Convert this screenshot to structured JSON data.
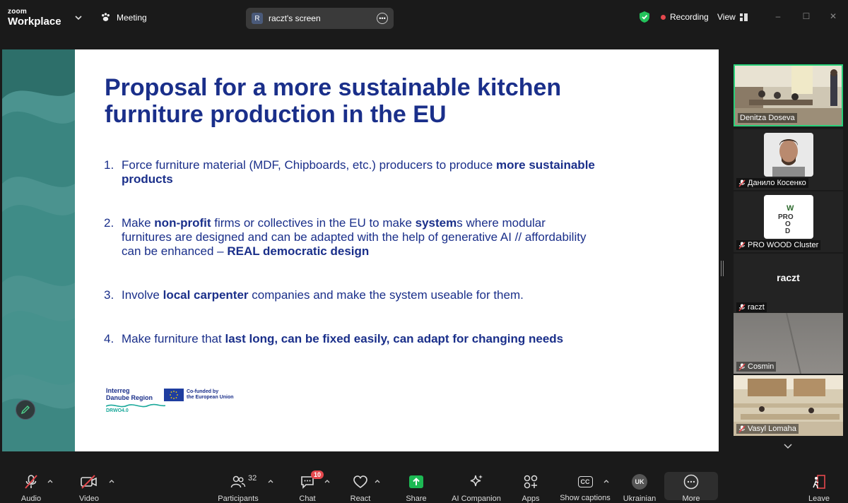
{
  "app": {
    "brand_small": "zoom",
    "brand_big": "Workplace",
    "meeting_label": "Meeting"
  },
  "share_pill": {
    "avatar_letter": "R",
    "label": "raczt's screen"
  },
  "status": {
    "recording": "Recording",
    "view": "View"
  },
  "slide": {
    "title": "Proposal for a more sustainable kitchen furniture production in the EU",
    "items": [
      {
        "num": "1.",
        "parts": [
          {
            "t": "Force furniture material (MDF, Chipboards, etc.) producers to produce ",
            "b": false
          },
          {
            "t": "more sustainable products",
            "b": true
          }
        ]
      },
      {
        "num": "2.",
        "parts": [
          {
            "t": "Make ",
            "b": false
          },
          {
            "t": "non-profit",
            "b": true
          },
          {
            "t": " firms or collectives in the EU to make ",
            "b": false
          },
          {
            "t": "system",
            "b": true
          },
          {
            "t": "s where modular furnitures are designed and can be adapted with the help of generative AI // affordability can be enhanced – ",
            "b": false
          },
          {
            "t": "REAL democratic design",
            "b": true
          }
        ]
      },
      {
        "num": "3.",
        "parts": [
          {
            "t": "Involve ",
            "b": false
          },
          {
            "t": "local carpenter",
            "b": true
          },
          {
            "t": " companies and make the system useable for them.",
            "b": false
          }
        ]
      },
      {
        "num": "4.",
        "parts": [
          {
            "t": "Make furniture that ",
            "b": false
          },
          {
            "t": "last long, can be fixed easily, can adapt for changing needs",
            "b": true
          }
        ]
      }
    ],
    "logo_interreg_1": "Interreg",
    "logo_interreg_2": "Danube Region",
    "logo_eu_1": "Co-funded by",
    "logo_eu_2": "the European Union",
    "logo_drwo": "DRWO4.0"
  },
  "participants": [
    {
      "name": "Denitza Doseva",
      "muted": false,
      "active": true,
      "kind": "video-room"
    },
    {
      "name": "Данило Косенко",
      "muted": true,
      "active": false,
      "kind": "photo-person"
    },
    {
      "name": "PRO WOOD Cluster",
      "muted": true,
      "active": false,
      "kind": "logo",
      "logo_text": "PRO WOOD"
    },
    {
      "name": "raczt",
      "muted": true,
      "active": false,
      "kind": "name-only",
      "center_name": "raczt"
    },
    {
      "name": "Cosmin",
      "muted": true,
      "active": false,
      "kind": "video-grey"
    },
    {
      "name": "Vasyl Lomaha",
      "muted": true,
      "active": false,
      "kind": "video-class"
    }
  ],
  "toolbar": {
    "audio": "Audio",
    "video": "Video",
    "participants": "Participants",
    "participants_count": "32",
    "chat": "Chat",
    "chat_badge": "10",
    "react": "React",
    "share": "Share",
    "ai_companion": "AI Companion",
    "apps": "Apps",
    "captions": "Show captions",
    "captions_icon": "CC",
    "language": "Ukrainian",
    "language_icon": "UK",
    "more": "More",
    "leave": "Leave"
  },
  "colors": {
    "accent_green": "#29d07a",
    "record_red": "#e5484d",
    "slide_blue": "#1a2f8a",
    "slide_teal": "#3a8a85",
    "share_green": "#1db954"
  }
}
